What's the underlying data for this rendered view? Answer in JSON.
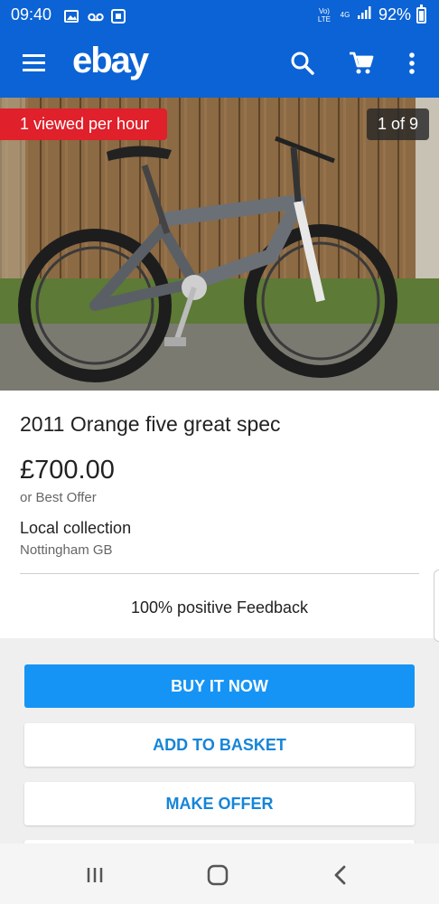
{
  "status_bar": {
    "time": "09:40",
    "volte_label": "Vo) LTE",
    "network": "4G",
    "battery": "92%"
  },
  "app_bar": {
    "logo": "ebay",
    "icons": [
      "menu-icon",
      "search-icon",
      "cart-icon",
      "more-vert-icon"
    ]
  },
  "listing": {
    "viewed_badge": "1 viewed per hour",
    "image_counter": "1 of 9",
    "title": "2011 Orange five great spec",
    "price": "£700.00",
    "price_note": "or Best Offer",
    "delivery": "Local collection",
    "location": "Nottingham GB",
    "seller_feedback": "100% positive Feedback"
  },
  "actions": {
    "buy_now": "BUY IT NOW",
    "add_to_basket": "ADD TO BASKET",
    "make_offer": "MAKE OFFER"
  },
  "colors": {
    "brand_blue": "#0b63d5",
    "button_blue": "#1694f5",
    "badge_red": "#e0202a"
  }
}
